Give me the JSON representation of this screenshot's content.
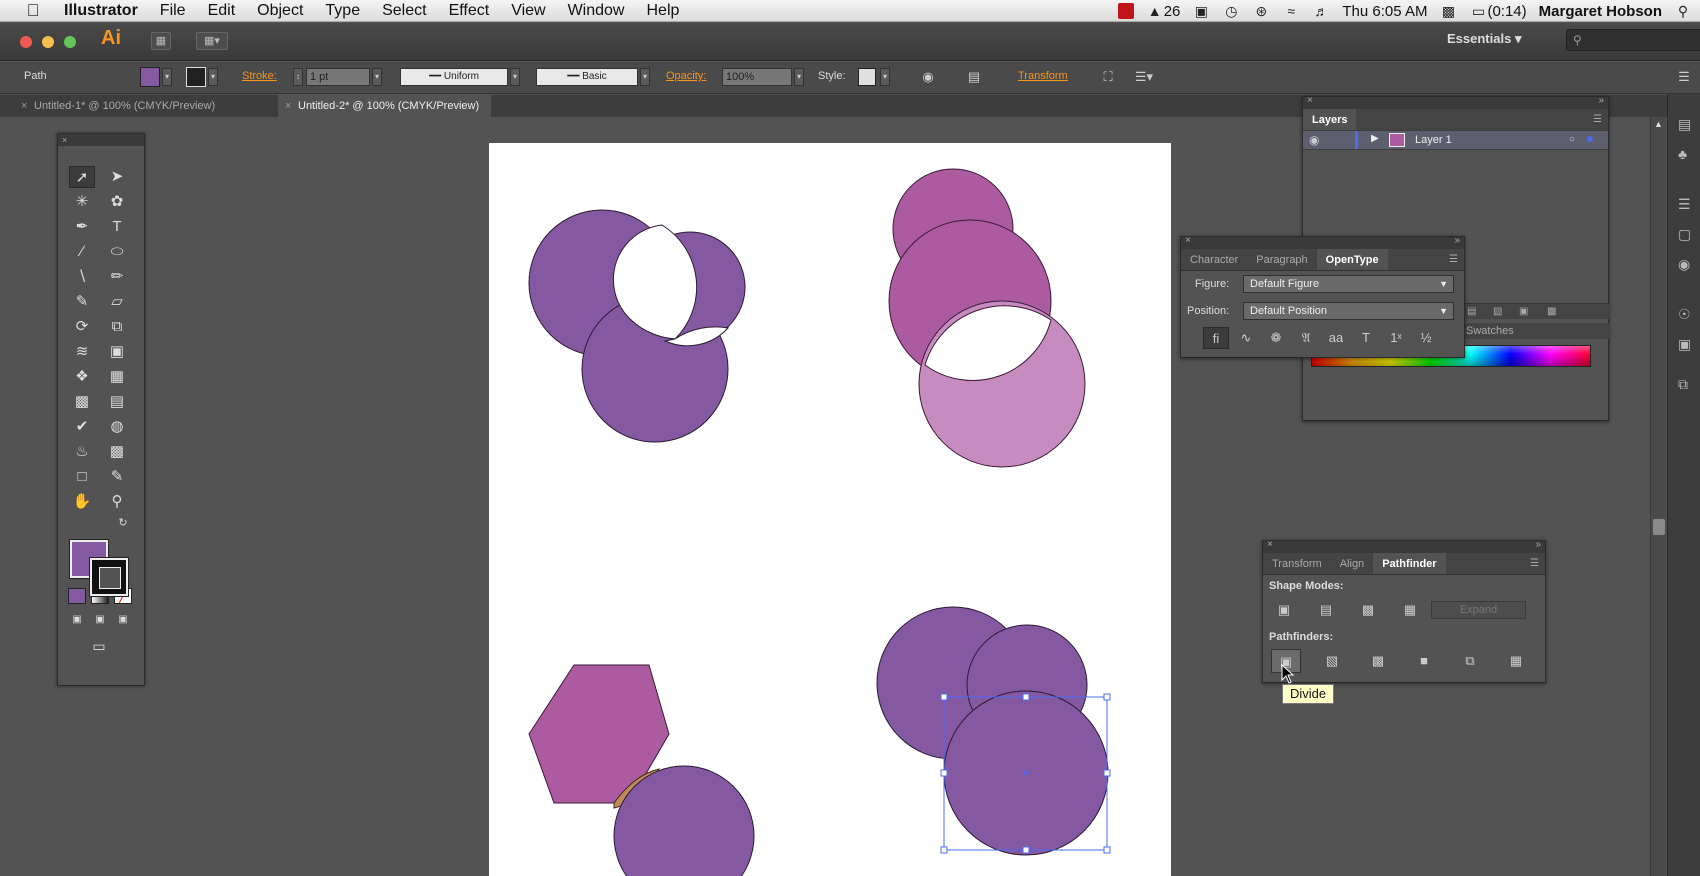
{
  "menubar": {
    "app": "Illustrator",
    "items": [
      "File",
      "Edit",
      "Object",
      "Type",
      "Select",
      "Effect",
      "View",
      "Window",
      "Help"
    ],
    "adobe_count": "26",
    "clock": "Thu 6:05 AM",
    "battery": "(0:14)",
    "user": "Margaret Hobson"
  },
  "appbar": {
    "logo": "Ai",
    "workspace": "Essentials"
  },
  "controlbar": {
    "selection_type": "Path",
    "stroke_label": "Stroke:",
    "stroke_value": "1 pt",
    "profile_label": "Uniform",
    "brush_label": "Basic",
    "opacity_label": "Opacity:",
    "opacity_value": "100%",
    "style_label": "Style:",
    "transform_label": "Transform",
    "fill_color": "#8559a1"
  },
  "tabs": [
    {
      "label": "Untitled-1* @ 100% (CMYK/Preview)",
      "active": false
    },
    {
      "label": "Untitled-2* @ 100% (CMYK/Preview)",
      "active": true
    }
  ],
  "layers_panel": {
    "title": "Layers",
    "layer_name": "Layer 1",
    "swatches_tab": "Swatches"
  },
  "character_panel": {
    "tabs": [
      "Character",
      "Paragraph",
      "OpenType"
    ],
    "active_tab": "OpenType",
    "figure_label": "Figure:",
    "figure_value": "Default Figure",
    "position_label": "Position:",
    "position_value": "Default Position"
  },
  "pathfinder_panel": {
    "tabs": [
      "Transform",
      "Align",
      "Pathfinder"
    ],
    "active_tab": "Pathfinder",
    "shape_modes_label": "Shape Modes:",
    "expand_label": "Expand",
    "pathfinders_label": "Pathfinders:"
  },
  "tooltip": "Divide",
  "colors": {
    "purple": "#8559a1",
    "magenta": "#ad5ba0",
    "light_magenta": "#c68cc0",
    "tan": "#c08a5b",
    "selection": "#4a6cf7",
    "accent_orange": "#f7941d"
  }
}
